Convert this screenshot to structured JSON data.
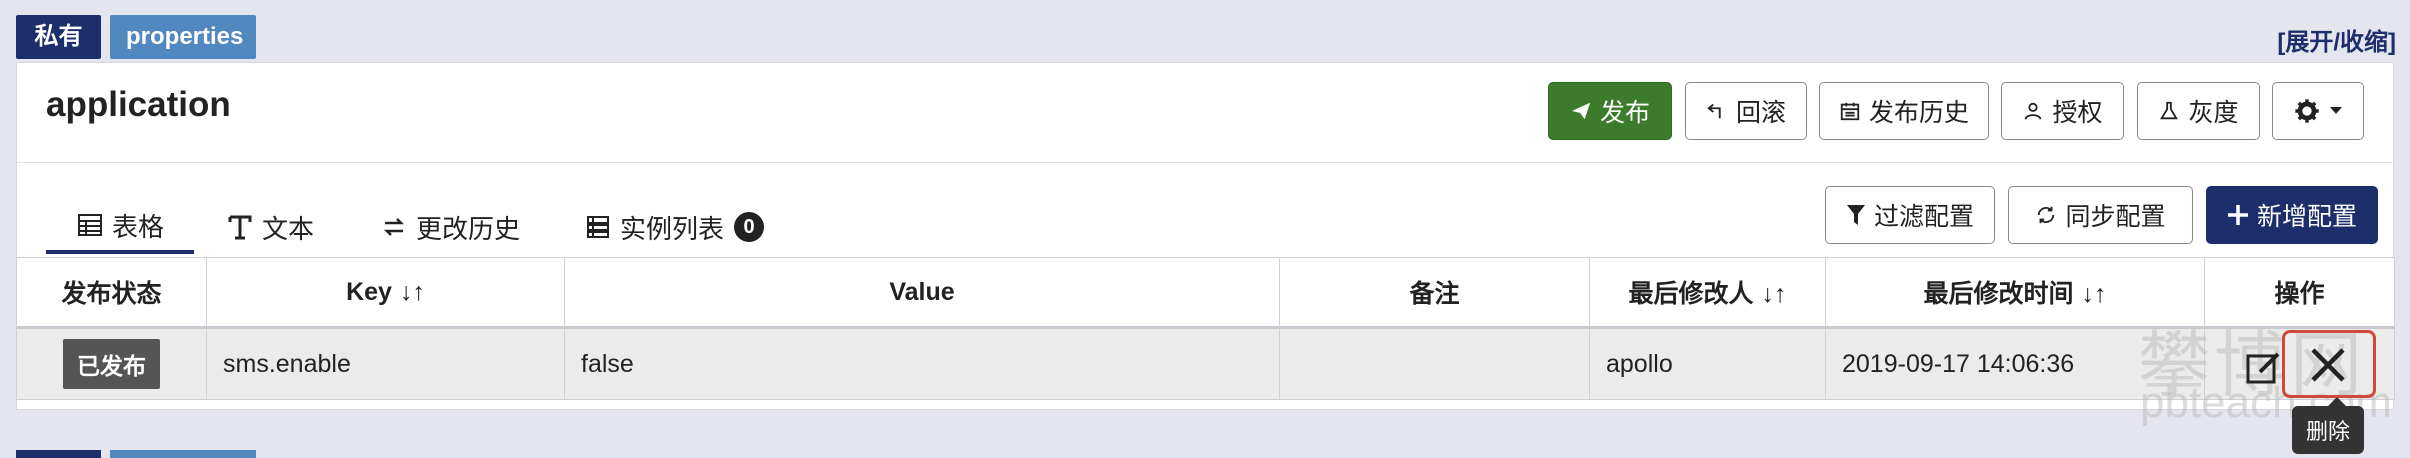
{
  "header": {
    "tag_private": "私有",
    "tag_namespace": "properties",
    "expand_link": "[展开/收缩]"
  },
  "panel": {
    "title": "application",
    "toolbar": {
      "publish": "发布",
      "rollback": "回滚",
      "history": "发布历史",
      "authorize": "授权",
      "gray": "灰度"
    },
    "tabs": [
      {
        "label": "表格"
      },
      {
        "label": "文本"
      },
      {
        "label": "更改历史"
      },
      {
        "label": "实例列表",
        "badge": "0"
      }
    ],
    "actions": {
      "filter": "过滤配置",
      "sync": "同步配置",
      "add": "新增配置"
    },
    "table": {
      "columns": [
        "发布状态",
        "Key",
        "Value",
        "备注",
        "最后修改人",
        "最后修改时间",
        "操作"
      ],
      "rows": [
        {
          "status": "已发布",
          "key": "sms.enable",
          "value": "false",
          "comment": "",
          "modifier": "apollo",
          "modified_time": "2019-09-17 14:06:36"
        }
      ]
    },
    "tooltip": "删除"
  },
  "watermark": {
    "line1": "攀博网",
    "line2": "pbteach.com"
  },
  "colors": {
    "navy": "#1d2f6b",
    "blue": "#5288c0",
    "green": "#3b7b2b",
    "danger_outline": "#d04a3a"
  }
}
